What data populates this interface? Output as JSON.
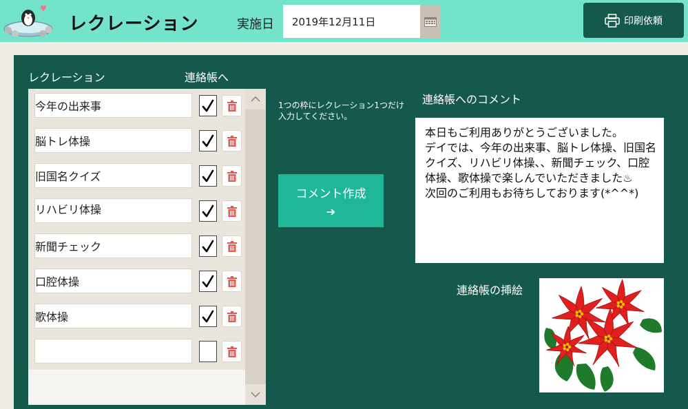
{
  "header": {
    "title": "レクレーション",
    "date_label": "実施日",
    "date_value": "2019年12月11日",
    "print_label": "印刷依頼"
  },
  "list": {
    "col_recreation": "レクレーション",
    "col_notebook": "連絡帳へ",
    "items": [
      {
        "text": "今年の出来事",
        "checked": true
      },
      {
        "text": "脳トレ体操",
        "checked": true
      },
      {
        "text": "旧国名クイズ",
        "checked": true
      },
      {
        "text": "リハビリ体操",
        "checked": true
      },
      {
        "text": "新聞チェック",
        "checked": true
      },
      {
        "text": "口腔体操",
        "checked": true
      },
      {
        "text": "歌体操",
        "checked": true
      },
      {
        "text": "",
        "checked": false
      }
    ]
  },
  "hint": "1つの枠にレクレーション1つだけ入力してください。",
  "make_comment": {
    "label": "コメント作成",
    "arrow": "➔"
  },
  "comment": {
    "label": "連絡帳へのコメント",
    "text": "本日もご利用ありがとうございました。\nデイでは、今年の出来事、脳トレ体操、旧国名クイズ、リハビリ体操、、新聞チェック、口腔体操、歌体操で楽しんでいただきました♨\n次回のご利用もお待ちしております(*^^*)"
  },
  "illustration": {
    "label": "連絡帳の挿絵",
    "subject": "poinsettia",
    "colors": {
      "petal": "#e0201e",
      "leaf": "#1f7a2c",
      "center": "#f2c200"
    }
  },
  "colors": {
    "header_bg": "#74e3cc",
    "panel_bg": "#15594c",
    "accent_button": "#1fb699",
    "delete_icon": "#e05a52"
  }
}
